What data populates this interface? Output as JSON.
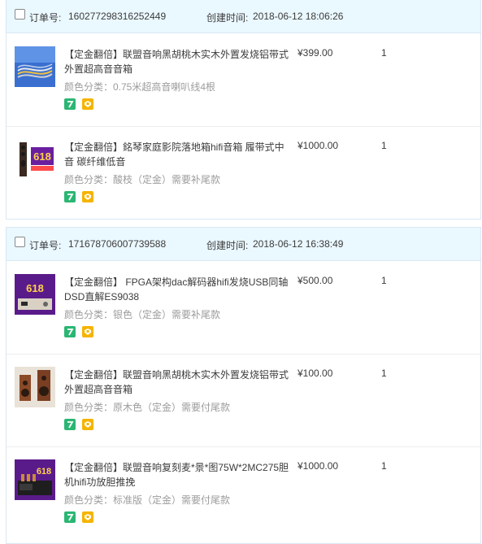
{
  "orders": [
    {
      "order_label": "订单号:",
      "order_no": "160277298316252449",
      "time_label": "创建时间:",
      "created": "2018-06-12 18:06:26",
      "items": [
        {
          "title": "【定金翻倍】联盟音响黑胡桃木实木外置发烧铝带式外置超高音音箱",
          "sku": "颜色分类：0.75米超高音喇叭线4根",
          "price": "¥399.00",
          "qty": "1",
          "thumb": "cable"
        },
        {
          "title": "【定金翻倍】銘琴家庭影院落地箱hifi音箱 履带式中音 碳纤维低音",
          "sku": "颜色分类：酸枝（定金）需要补尾款",
          "price": "¥1000.00",
          "qty": "1",
          "thumb": "promo-618"
        }
      ]
    },
    {
      "order_label": "订单号:",
      "order_no": "171678706007739588",
      "time_label": "创建时间:",
      "created": "2018-06-12 16:38:49",
      "items": [
        {
          "title": "【定金翻倍】 FPGA架构dac解码器hifi发烧USB同轴DSD直解ES9038",
          "sku": "颜色分类：银色（定金）需要补尾款",
          "price": "¥500.00",
          "qty": "1",
          "thumb": "promo-618-device"
        },
        {
          "title": "【定金翻倍】联盟音响黑胡桃木实木外置发烧铝带式外置超高音音箱",
          "sku": "颜色分类：原木色（定金）需要付尾款",
          "price": "¥100.00",
          "qty": "1",
          "thumb": "speakers"
        },
        {
          "title": "【定金翻倍】联盟音响复刻麦*景*图75W*2MC275胆机hifi功放胆推挽",
          "sku": "颜色分类：标准版（定金）需要付尾款",
          "price": "¥1000.00",
          "qty": "1",
          "thumb": "promo-618-amp"
        }
      ]
    }
  ],
  "badge_icons": [
    "seven-day-return-icon",
    "consumer-protection-icon"
  ],
  "colors": {
    "header_bg": "#eaf8ff",
    "border": "#d9e8f3",
    "badge_green": "#2bb673",
    "badge_yellow": "#f5b400",
    "promo_purple": "#6a1fa0"
  }
}
